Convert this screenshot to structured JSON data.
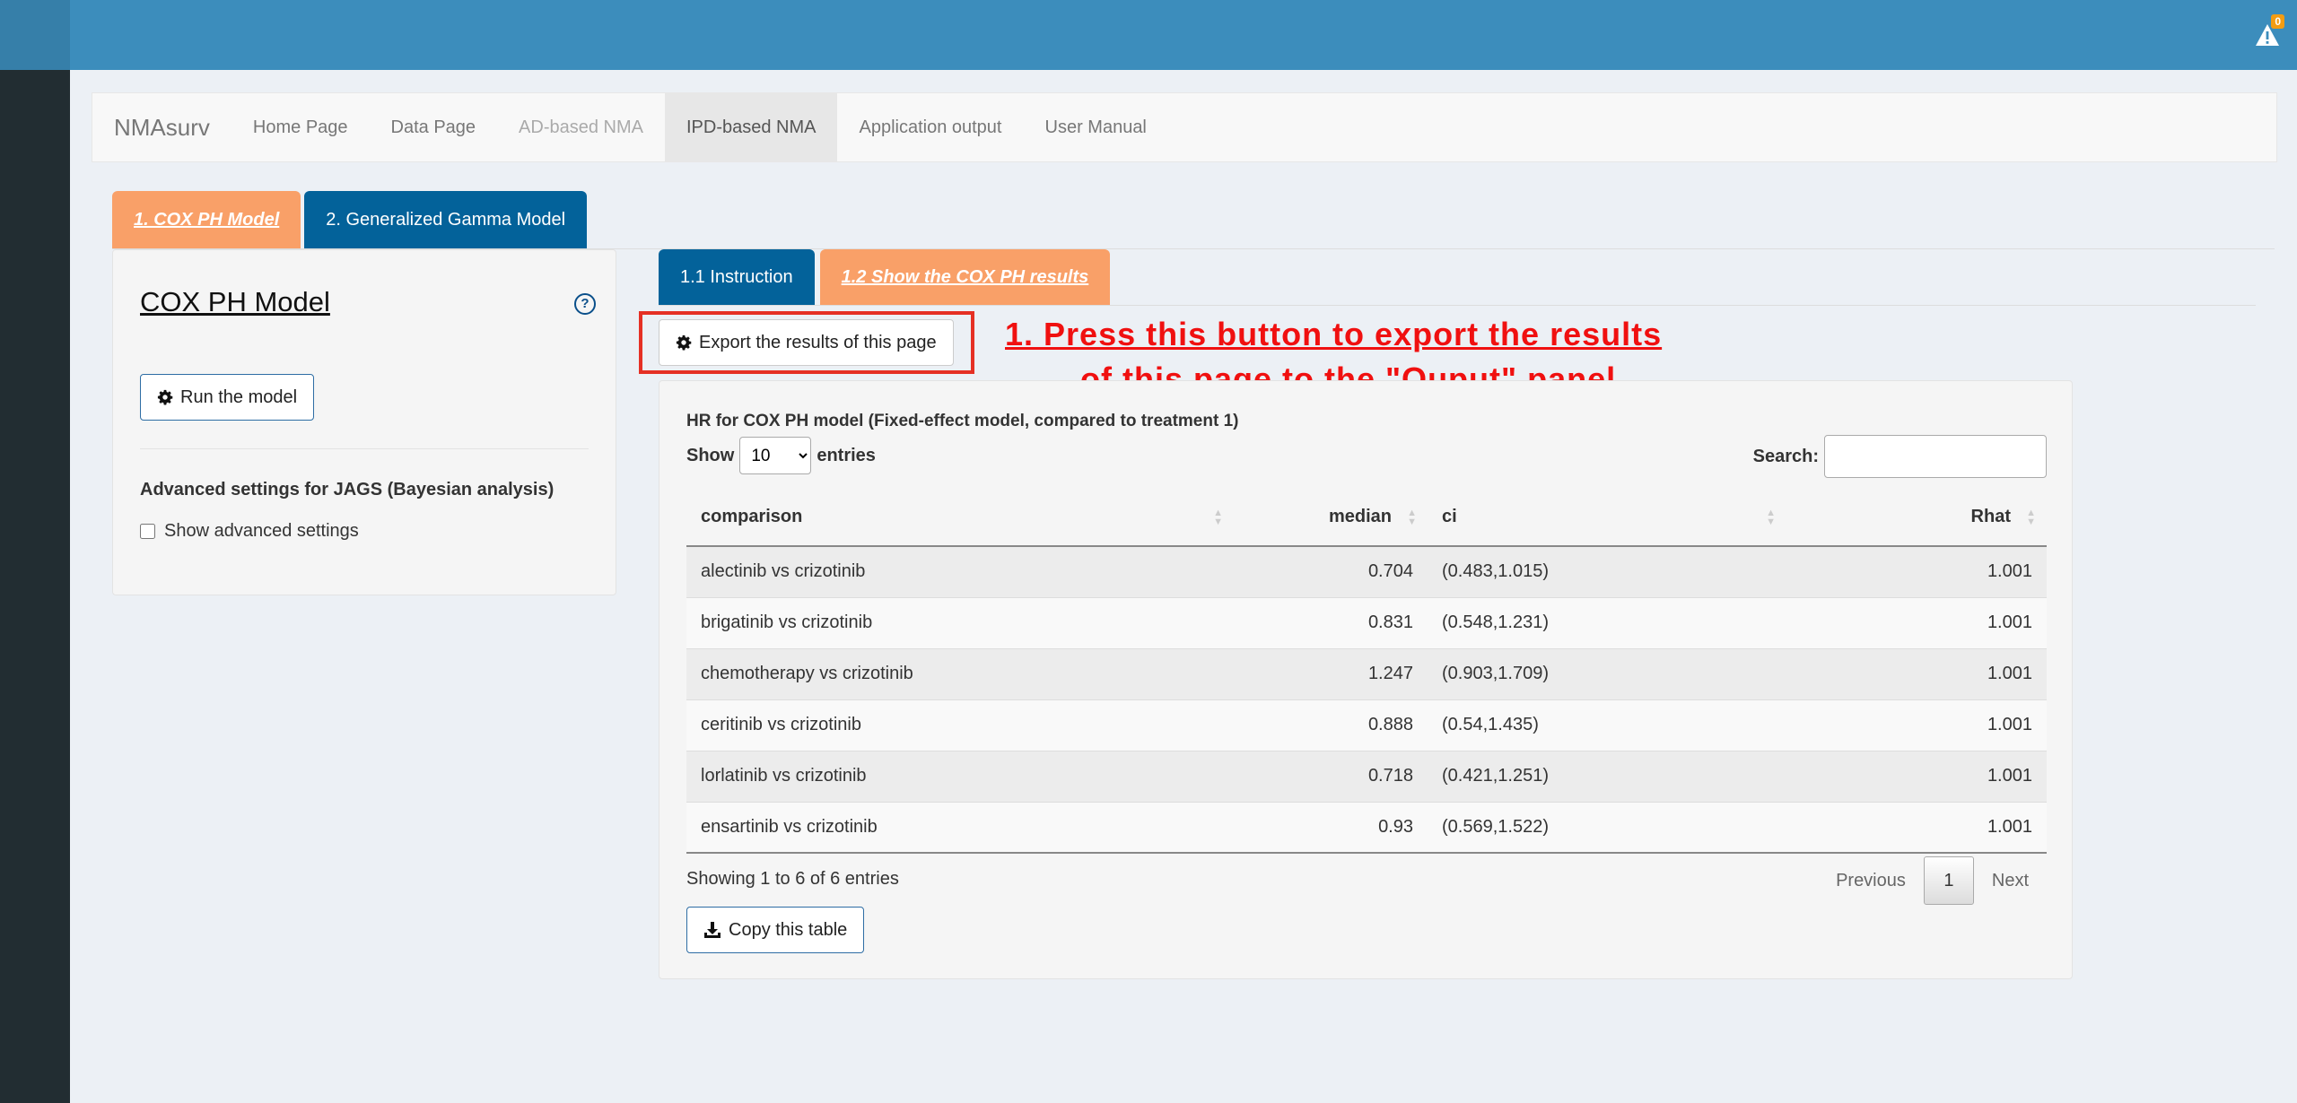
{
  "topbar": {
    "notification_count": "0",
    "notification_icon": "warning-triangle-icon"
  },
  "navbar": {
    "brand": "NMAsurv",
    "items": [
      {
        "label": "Home Page"
      },
      {
        "label": "Data Page"
      },
      {
        "label": "AD-based NMA"
      },
      {
        "label": "IPD-based NMA"
      },
      {
        "label": "Application output"
      },
      {
        "label": "User Manual"
      }
    ],
    "active": "IPD-based NMA"
  },
  "model_tabs": [
    {
      "label": "1. COX PH Model"
    },
    {
      "label": "2. Generalized Gamma Model"
    }
  ],
  "left_panel": {
    "title": "COX PH Model",
    "help_icon": "?",
    "run_button": "Run the model",
    "advanced_title": "Advanced settings for JAGS (Bayesian analysis)",
    "advanced_checkbox": "Show advanced settings"
  },
  "sub_tabs": [
    {
      "label": "1.1 Instruction"
    },
    {
      "label": "1.2 Show the COX PH results"
    }
  ],
  "export_button": "Export the results of this page",
  "annotation": {
    "line1": "1. Press this button to export the results",
    "line2": "of this page to the \"Ouput\" panel"
  },
  "table": {
    "title": "HR for COX PH model (Fixed-effect model, compared to treatment 1)",
    "show_label": "Show",
    "entries_value": "10",
    "entries_label": "entries",
    "search_label": "Search:",
    "columns": [
      "comparison",
      "median",
      "ci",
      "Rhat"
    ],
    "rows": [
      [
        "alectinib vs crizotinib",
        "0.704",
        "(0.483,1.015)",
        "1.001"
      ],
      [
        "brigatinib vs crizotinib",
        "0.831",
        "(0.548,1.231)",
        "1.001"
      ],
      [
        "chemotherapy vs crizotinib",
        "1.247",
        "(0.903,1.709)",
        "1.001"
      ],
      [
        "ceritinib vs crizotinib",
        "0.888",
        "(0.54,1.435)",
        "1.001"
      ],
      [
        "lorlatinib vs crizotinib",
        "0.718",
        "(0.421,1.251)",
        "1.001"
      ],
      [
        "ensartinib vs crizotinib",
        "0.93",
        "(0.569,1.522)",
        "1.001"
      ]
    ],
    "info": "Showing 1 to 6 of 6 entries",
    "pager": {
      "previous": "Previous",
      "current": "1",
      "next": "Next"
    },
    "copy_button": "Copy this table"
  }
}
